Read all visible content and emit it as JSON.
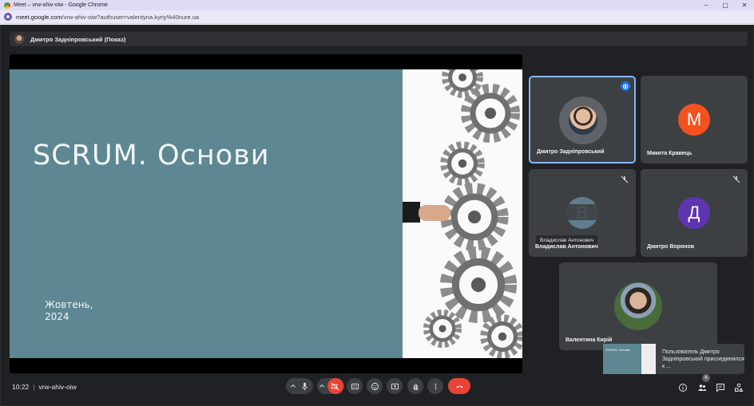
{
  "browser": {
    "window_title": "Meet – vrw-ahiv-oiw - Google Chrome",
    "url_host": "meet.google.com",
    "url_path": "/vrw-ahiv-oiw?authuser=valentyna.kyriy%40nure.ua",
    "controls": {
      "minimize": "–",
      "maximize": "▢",
      "close": "✕"
    }
  },
  "presenter": {
    "label": "Дмитро Задніпровський (Показ)"
  },
  "slide": {
    "title": "SCRUM. Основи",
    "date_line1": "Жовтень,",
    "date_line2": "2024"
  },
  "participants": [
    {
      "name": "Дмитро Задніпровський"
    },
    {
      "name": "Микита Кравець",
      "initial": "М",
      "color": "#f4511e"
    },
    {
      "name": "Владислав Антонович",
      "initial": "В",
      "tooltip": "Владислав Антонович"
    },
    {
      "name": "Дмитро Воронов",
      "initial": "Д",
      "color": "#5e35b1"
    },
    {
      "name": "Валентина Кирій"
    }
  ],
  "toast": {
    "thumb_title": "SCRUM. Основи",
    "text": "Пользователь Дмитро Задніпровський присоединился к ..."
  },
  "bottom": {
    "time": "10:22",
    "meeting_code": "vrw-ahiv-oiw",
    "people_count": "6"
  }
}
